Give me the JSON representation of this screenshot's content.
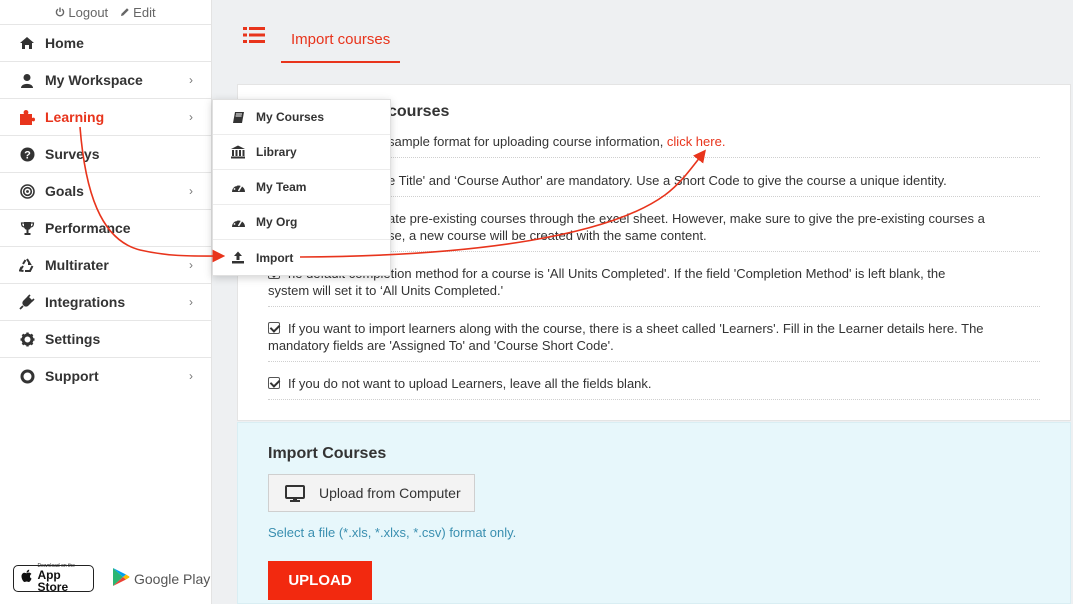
{
  "topbar": {
    "logout": "Logout",
    "edit": "Edit"
  },
  "sidebar": {
    "items": [
      {
        "label": "Home",
        "icon": "home-icon"
      },
      {
        "label": "My Workspace",
        "icon": "user-icon"
      },
      {
        "label": "Learning",
        "icon": "puzzle-icon",
        "active": true
      },
      {
        "label": "Surveys",
        "icon": "question-icon"
      },
      {
        "label": "Goals",
        "icon": "target-icon"
      },
      {
        "label": "Performance",
        "icon": "trophy-icon"
      },
      {
        "label": "Multirater",
        "icon": "recycle-icon"
      },
      {
        "label": "Integrations",
        "icon": "plug-icon"
      },
      {
        "label": "Settings",
        "icon": "gear-icon"
      },
      {
        "label": "Support",
        "icon": "lifebuoy-icon"
      }
    ],
    "chevron": "›",
    "app_store": {
      "small": "Download on the",
      "big": "App Store"
    },
    "google_play": "Google Play"
  },
  "dropdown": {
    "items": [
      {
        "label": "My Courses",
        "icon": "book-icon"
      },
      {
        "label": "Library",
        "icon": "library-icon"
      },
      {
        "label": "My Team",
        "icon": "dashboard-icon"
      },
      {
        "label": "My Org",
        "icon": "dashboard-icon"
      },
      {
        "label": "Import",
        "icon": "upload-icon"
      }
    ]
  },
  "header": {
    "tab_label": "Import courses"
  },
  "info": {
    "title": "courses",
    "rows": [
      {
        "text": "sample format for uploading course information, ",
        "link": "click here."
      },
      {
        "text": "e Title' and ‘Course Author' are mandatory. Use a Short Code to give the course a unique identity."
      },
      {
        "text": "ate pre-existing courses through the excel sheet. However, make sure to give the pre-existing courses a",
        "text2": "se, a new course will be created with the same content."
      },
      {
        "text": "he default completion method for a course is 'All Units Completed'. If the field 'Completion Method' is left blank, the",
        "text2": "system will set it to ‘All Units Completed.'"
      },
      {
        "text": "If you want to import learners along with the course, there is a sheet called 'Learners'. Fill in the Learner details here. The",
        "text2": "mandatory fields are 'Assigned To' and 'Course Short Code'."
      },
      {
        "text": "If you do not want to upload Learners, leave all the fields blank."
      }
    ]
  },
  "import": {
    "title": "Import Courses",
    "upload_from_computer": "Upload from Computer",
    "hint": "Select a file (*.xls, *.xlxs, *.csv) format only.",
    "upload_button": "UPLOAD"
  },
  "colors": {
    "accent": "#e8341c",
    "upload": "#f2290f",
    "hint": "#3a8fb0",
    "import_bg": "#e7f7fb"
  }
}
